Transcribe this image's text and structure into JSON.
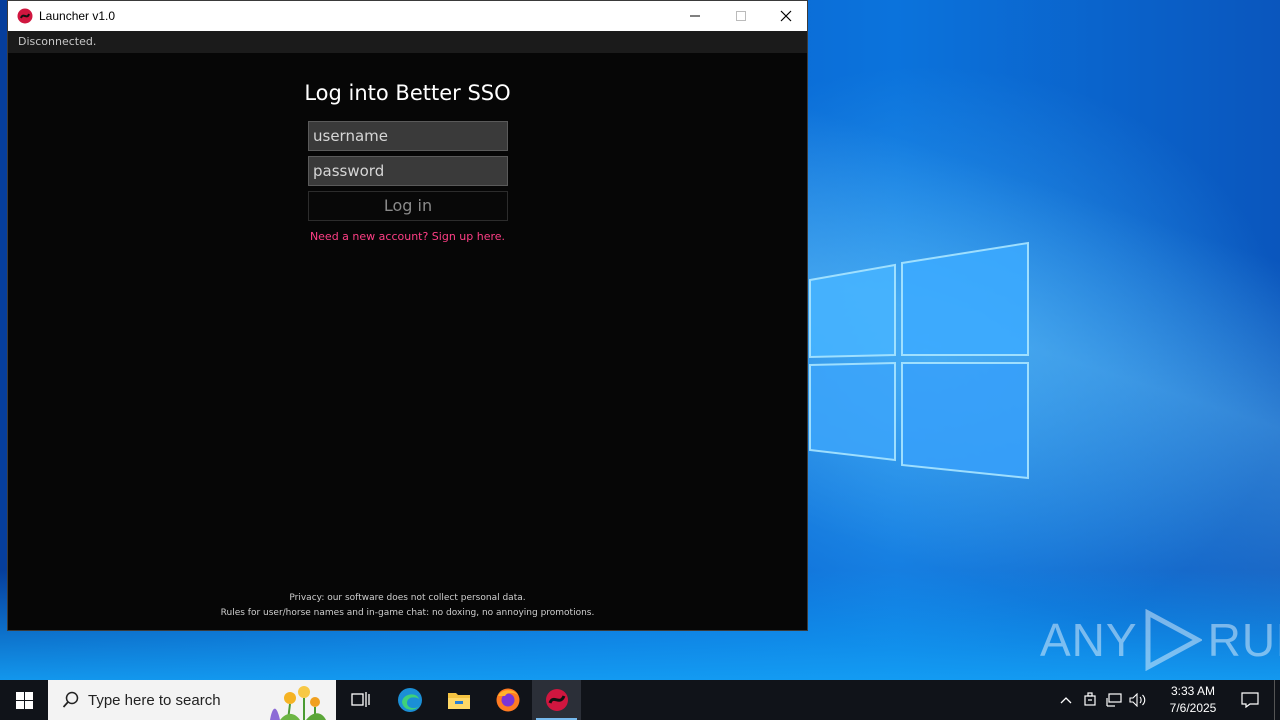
{
  "window": {
    "title": "Launcher v1.0",
    "status": "Disconnected."
  },
  "login": {
    "title": "Log into Better SSO",
    "username_placeholder": "username",
    "password_placeholder": "password",
    "login_label": "Log in",
    "signup_link": "Need a new account? Sign up here."
  },
  "footer": {
    "privacy": "Privacy: our software does not collect personal data.",
    "rules": "Rules for user/horse names and in-game chat: no doxing, no annoying promotions."
  },
  "taskbar": {
    "search_placeholder": "Type here to search",
    "apps": [
      "task-view-icon",
      "edge-icon",
      "file-explorer-icon",
      "firefox-icon",
      "launcher-icon"
    ],
    "clock_time": "3:33 AM",
    "clock_date": "7/6/2025"
  },
  "watermark": {
    "text_left": "ANY",
    "text_right": "RUN"
  },
  "colors": {
    "accent_pink": "#ff3f86",
    "window_bg": "#060606",
    "taskbar_bg": "#101319"
  }
}
